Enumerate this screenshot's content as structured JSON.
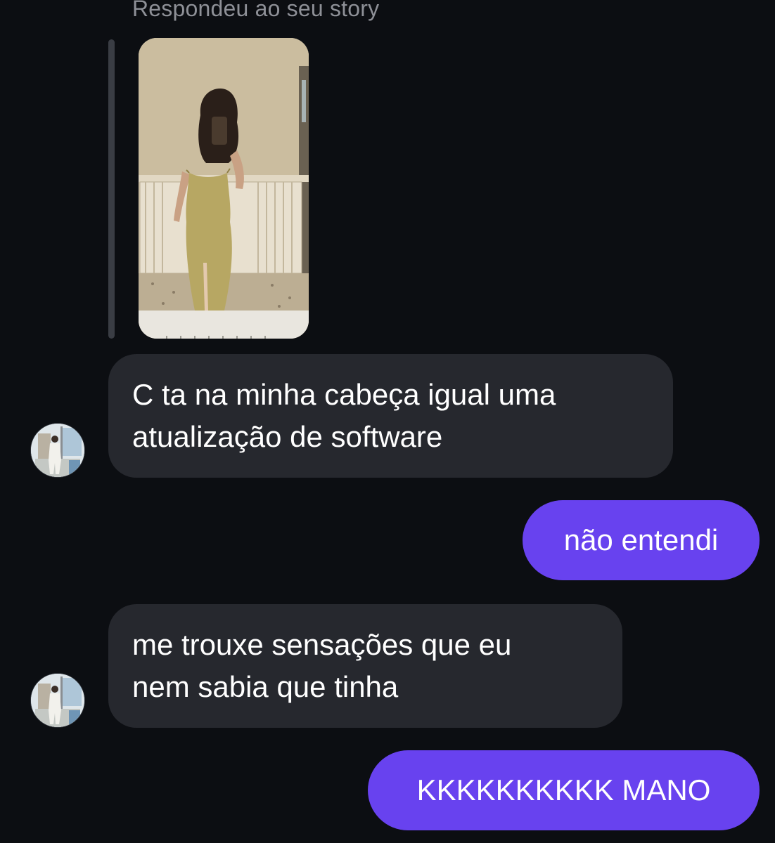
{
  "thread": {
    "story_reply_label": "Respondeu ao seu story",
    "messages": [
      {
        "direction": "incoming",
        "lines": [
          "C ta na minha cabeça igual uma",
          "atualização de software"
        ]
      },
      {
        "direction": "outgoing",
        "text": "não entendi"
      },
      {
        "direction": "incoming",
        "lines": [
          "me trouxe sensações que eu",
          "nem sabia que tinha"
        ]
      },
      {
        "direction": "outgoing",
        "text": "KKKKKKKKKK MANO"
      }
    ]
  },
  "colors": {
    "background": "#0c0e12",
    "incoming_bubble": "#26282e",
    "outgoing_bubble": "#6842ef",
    "label_gray": "#8e9097"
  }
}
